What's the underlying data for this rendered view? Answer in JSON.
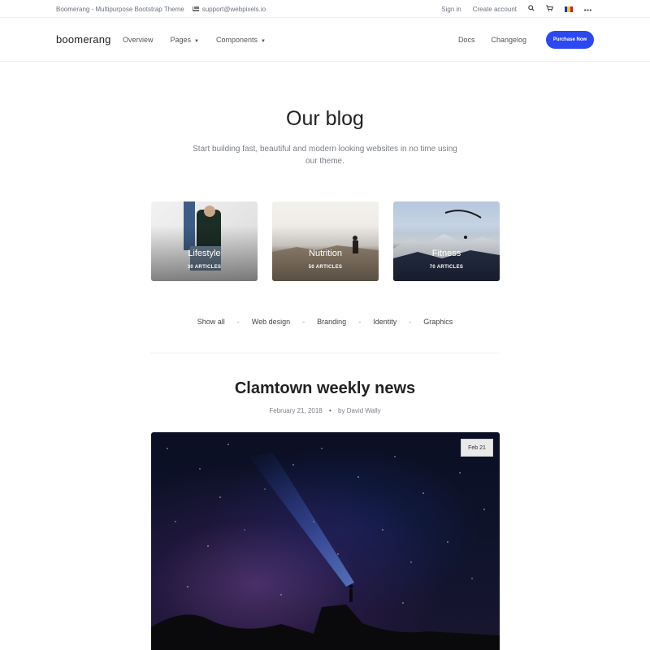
{
  "topbar": {
    "site_title": "Boomerang - Multipurpose Bootstrap Theme",
    "email": "support@webpixels.io",
    "sign_in": "Sign in",
    "create_account": "Create account"
  },
  "navbar": {
    "brand": "boomerang",
    "links": [
      "Overview",
      "Pages",
      "Components"
    ],
    "right_links": [
      "Docs",
      "Changelog"
    ],
    "purchase_label": "Purchase Now"
  },
  "hero": {
    "title": "Our blog",
    "subtitle": "Start building fast, beautiful and modern looking websites in no time using our theme."
  },
  "categories": [
    {
      "title": "Lifestyle",
      "count": "30 ARTICLES"
    },
    {
      "title": "Nutrition",
      "count": "50 ARTICLES"
    },
    {
      "title": "Fitness",
      "count": "70 ARTICLES"
    }
  ],
  "filters": [
    "Show all",
    "Web design",
    "Branding",
    "Identity",
    "Graphics"
  ],
  "post": {
    "title": "Clamtown weekly news",
    "date": "February 21, 2018",
    "author": "by David Wally",
    "badge": "Feb 21"
  },
  "colors": {
    "accent": "#2c48f0"
  }
}
